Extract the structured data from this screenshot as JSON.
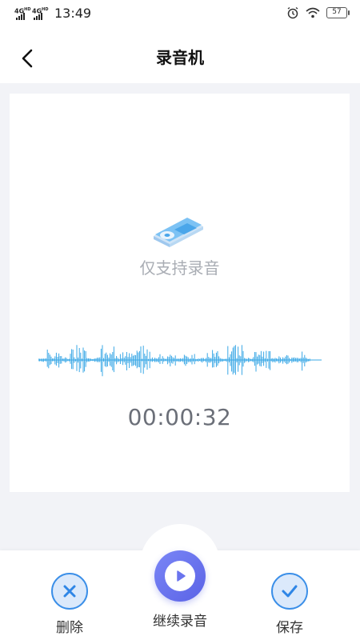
{
  "status_bar": {
    "network_1": "4G",
    "network_1_sup": "HD",
    "network_2": "4G",
    "network_2_sup": "HD",
    "time": "13:49",
    "battery": "57",
    "icons": [
      "alarm-icon",
      "wifi-icon",
      "battery-icon"
    ]
  },
  "header": {
    "title": "录音机",
    "back_icon": "back-chevron-icon"
  },
  "recorder": {
    "hint": "仅支持录音",
    "timer": "00:00:32",
    "icon": "media-player-icon",
    "wave_color": "#3aa8e6"
  },
  "actions": {
    "delete_label": "删除",
    "continue_label": "继续录音",
    "save_label": "保存"
  },
  "colors": {
    "accent": "#3b8fe8",
    "play_button": "#6a74ee",
    "background": "#f2f3f7"
  }
}
